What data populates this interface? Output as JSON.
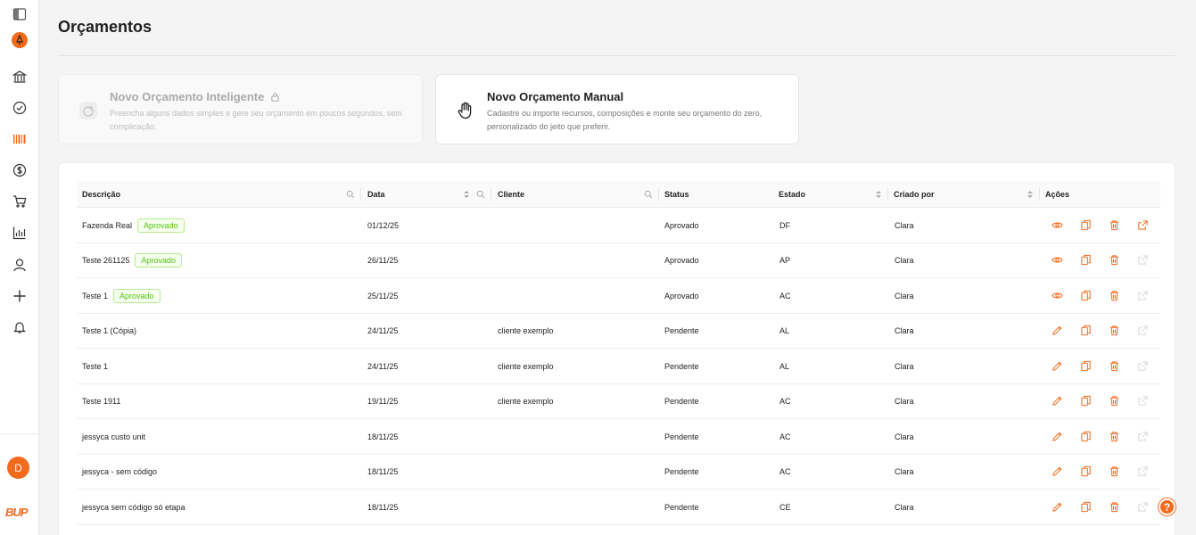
{
  "page": {
    "title": "Orçamentos"
  },
  "sidebar": {
    "items": [
      {
        "icon": "sidebar-toggle-icon"
      },
      {
        "icon": "org-logo-icon"
      },
      {
        "icon": "bank-icon"
      },
      {
        "icon": "check-circle-icon"
      },
      {
        "icon": "barcode-icon"
      },
      {
        "icon": "dollar-icon"
      },
      {
        "icon": "cart-icon"
      },
      {
        "icon": "chart-icon"
      },
      {
        "icon": "user-icon"
      },
      {
        "icon": "plus-icon"
      },
      {
        "icon": "bell-icon"
      }
    ],
    "avatar_initial": "D",
    "brand": "BUP"
  },
  "cards": {
    "smart": {
      "title": "Novo Orçamento Inteligente",
      "desc": "Preencha alguns dados simples e gere seu orçamento em poucos segundos, sem complicação."
    },
    "manual": {
      "title": "Novo Orçamento Manual",
      "desc": "Cadastre ou importe recursos, composições e monte seu orçamento do zero, personalizado do jeito que preferir."
    }
  },
  "table": {
    "columns": {
      "descricao": "Descrição",
      "data": "Data",
      "cliente": "Cliente",
      "status": "Status",
      "estado": "Estado",
      "criado_por": "Criado por",
      "acoes": "Ações"
    },
    "rows": [
      {
        "descricao": "Fazenda Real",
        "badge": "Aprovado",
        "data": "01/12/25",
        "cliente": "",
        "status": "Aprovado",
        "estado": "DF",
        "criado_por": "Clara",
        "mode": "view",
        "share": true
      },
      {
        "descricao": "Teste 261125",
        "badge": "Aprovado",
        "data": "26/11/25",
        "cliente": "",
        "status": "Aprovado",
        "estado": "AP",
        "criado_por": "Clara",
        "mode": "view",
        "share": false
      },
      {
        "descricao": "Teste 1",
        "badge": "Aprovado",
        "data": "25/11/25",
        "cliente": "",
        "status": "Aprovado",
        "estado": "AC",
        "criado_por": "Clara",
        "mode": "view",
        "share": false
      },
      {
        "descricao": "Teste 1 (Cópia)",
        "badge": "",
        "data": "24/11/25",
        "cliente": "cliente exemplo",
        "status": "Pendente",
        "estado": "AL",
        "criado_por": "Clara",
        "mode": "edit",
        "share": false
      },
      {
        "descricao": "Teste 1",
        "badge": "",
        "data": "24/11/25",
        "cliente": "cliente exemplo",
        "status": "Pendente",
        "estado": "AL",
        "criado_por": "Clara",
        "mode": "edit",
        "share": false
      },
      {
        "descricao": "Teste 1911",
        "badge": "",
        "data": "19/11/25",
        "cliente": "cliente exemplo",
        "status": "Pendente",
        "estado": "AC",
        "criado_por": "Clara",
        "mode": "edit",
        "share": false
      },
      {
        "descricao": "jessyca custo unit",
        "badge": "",
        "data": "18/11/25",
        "cliente": "",
        "status": "Pendente",
        "estado": "AC",
        "criado_por": "Clara",
        "mode": "edit",
        "share": false
      },
      {
        "descricao": "jessyca - sem código",
        "badge": "",
        "data": "18/11/25",
        "cliente": "",
        "status": "Pendente",
        "estado": "AC",
        "criado_por": "Clara",
        "mode": "edit",
        "share": false
      },
      {
        "descricao": "jessyca sem código só etapa",
        "badge": "",
        "data": "18/11/25",
        "cliente": "",
        "status": "Pendente",
        "estado": "CE",
        "criado_por": "Clara",
        "mode": "edit",
        "share": false
      }
    ]
  },
  "help": {
    "label": "?"
  },
  "colors": {
    "accent": "#f26a1b",
    "approved_green": "#52c41a",
    "disabled_icon": "#d9d9d9"
  }
}
